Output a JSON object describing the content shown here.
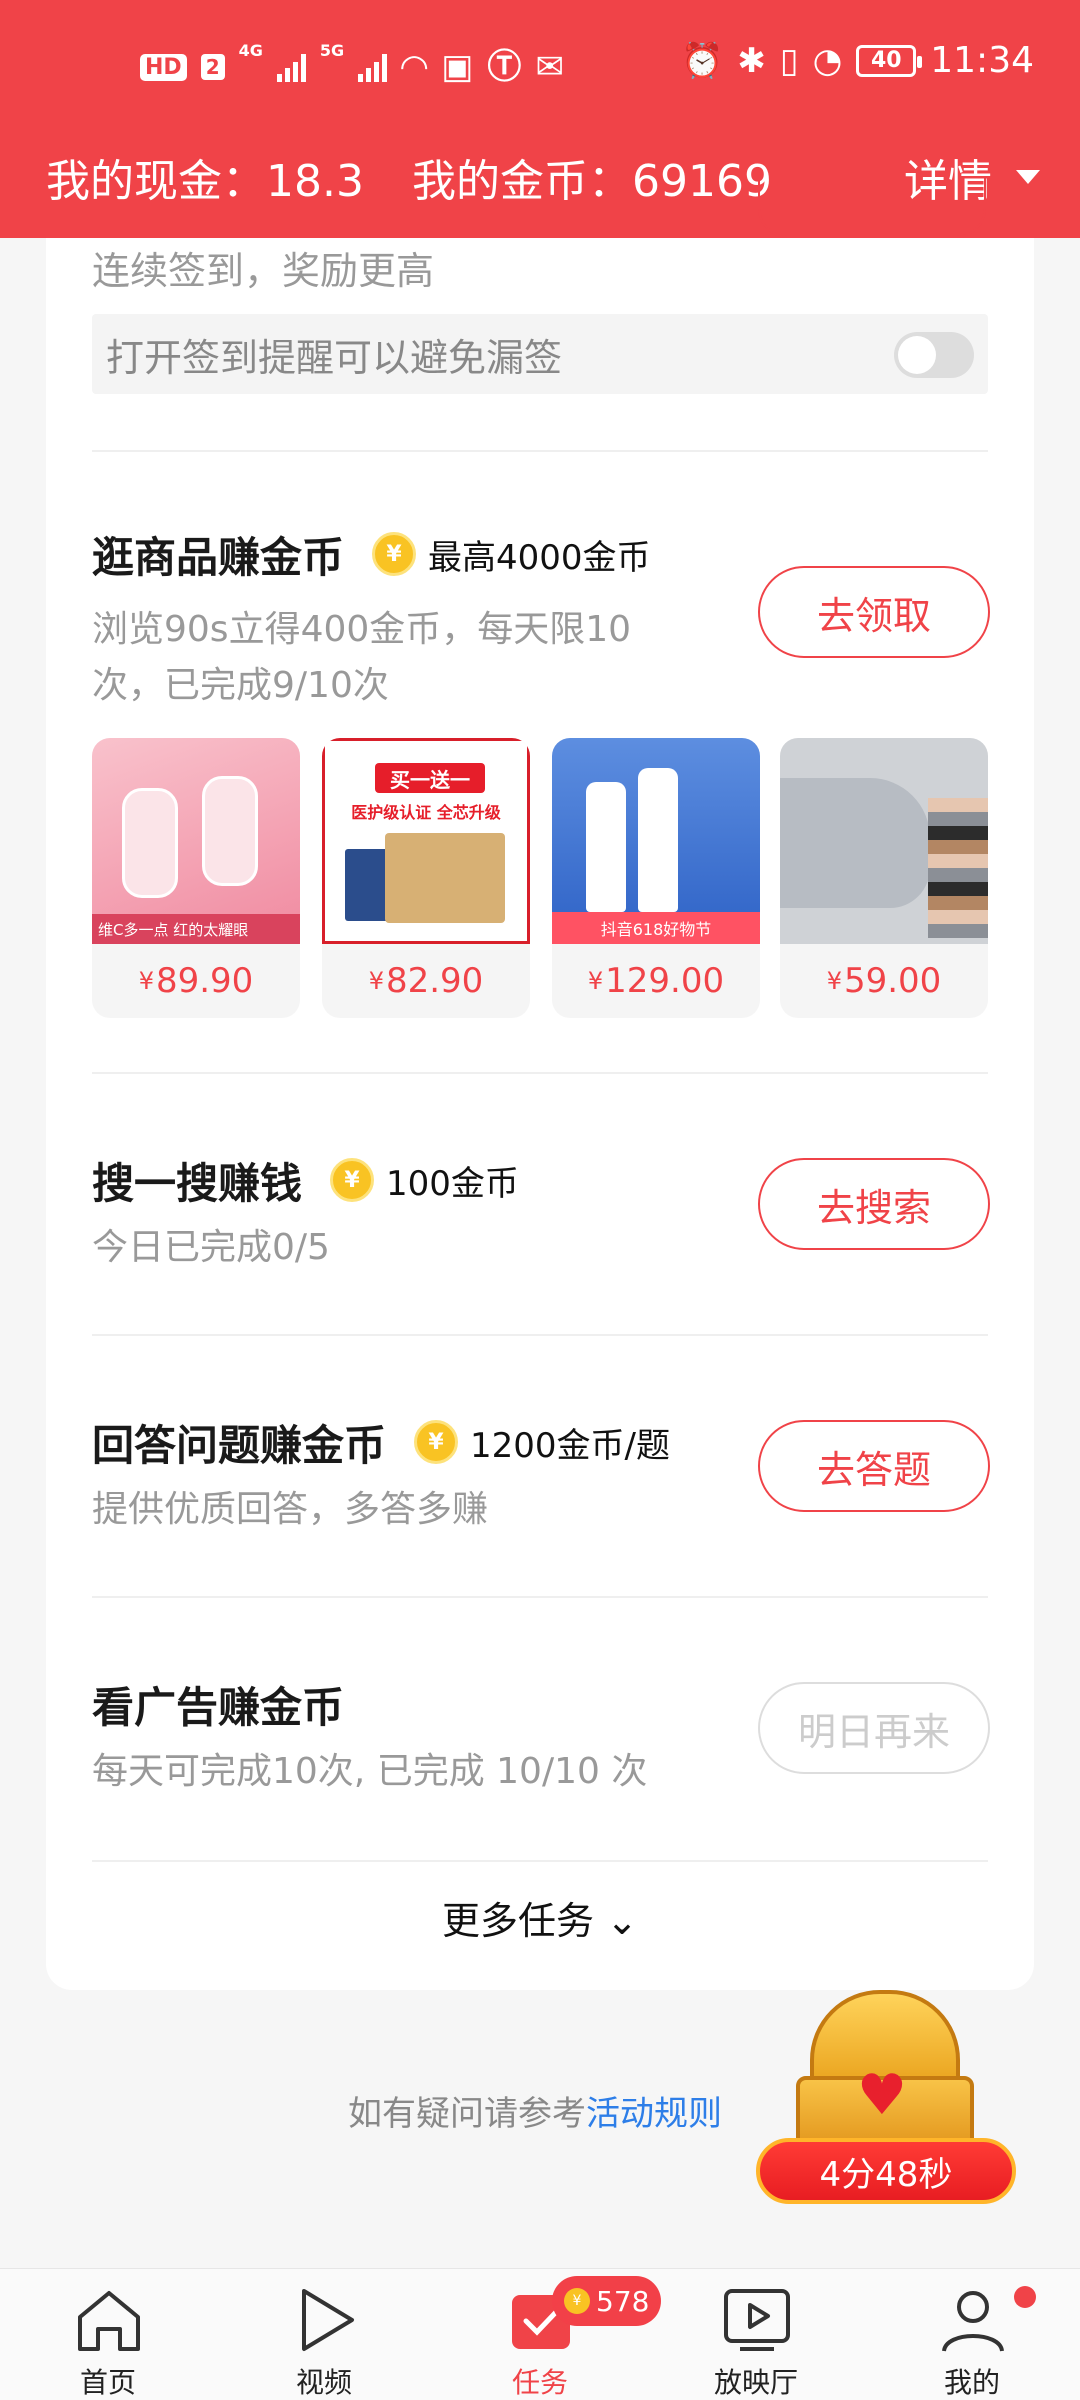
{
  "status_bar": {
    "hd": "HD",
    "sim": "2",
    "net1": "4G",
    "net2": "5G",
    "battery": "40",
    "time": "11:34"
  },
  "header": {
    "cash_label": "我的现金：18.3",
    "coin_label": "我的金币：69169",
    "detail_label": "详情"
  },
  "sign_in": {
    "subtitle": "连续签到，奖励更高",
    "reminder": "打开签到提醒可以避免漏签"
  },
  "tasks": [
    {
      "title": "逛商品赚金币",
      "reward": "最高4000金币",
      "desc_line1": "浏览90s立得400金币，每天限10",
      "desc_line2": "次，已完成9/10次",
      "button": "去领取"
    },
    {
      "title": "搜一搜赚钱",
      "reward": "100金币",
      "desc_line1": "今日已完成0/5",
      "button": "去搜索"
    },
    {
      "title": "回答问题赚金币",
      "reward": "1200金币/题",
      "desc_line1": "提供优质回答，多答多赚",
      "button": "去答题"
    },
    {
      "title": "看广告赚金币",
      "reward": "",
      "desc_line1": "每天可完成10次, 已完成 10/10 次",
      "button": "明日再来"
    }
  ],
  "products": [
    {
      "price": "89.90",
      "banner": "维C多一点 红的太耀眼"
    },
    {
      "price": "82.90",
      "tag": "买一送一",
      "sub": "医护级认证 全芯升级"
    },
    {
      "price": "129.00",
      "banner": "抖音618好物节"
    },
    {
      "price": "59.00"
    }
  ],
  "currency_symbol": "¥",
  "coin_symbol": "¥",
  "more_tasks": "更多任务 ⌄",
  "faq": {
    "text": "如有疑问请参考",
    "link": "活动规则"
  },
  "chest_timer": "4分48秒",
  "nav": {
    "items": [
      {
        "label": "首页",
        "icon": "home-icon"
      },
      {
        "label": "视频",
        "icon": "play-icon"
      },
      {
        "label": "任务",
        "icon": "task-icon"
      },
      {
        "label": "放映厅",
        "icon": "screen-icon"
      },
      {
        "label": "我的",
        "icon": "profile-icon"
      }
    ],
    "badge_count": "578"
  },
  "colors": {
    "brand_red": "#f04348",
    "link_blue": "#2d7ee8",
    "coin_gold": "#f9c323"
  }
}
